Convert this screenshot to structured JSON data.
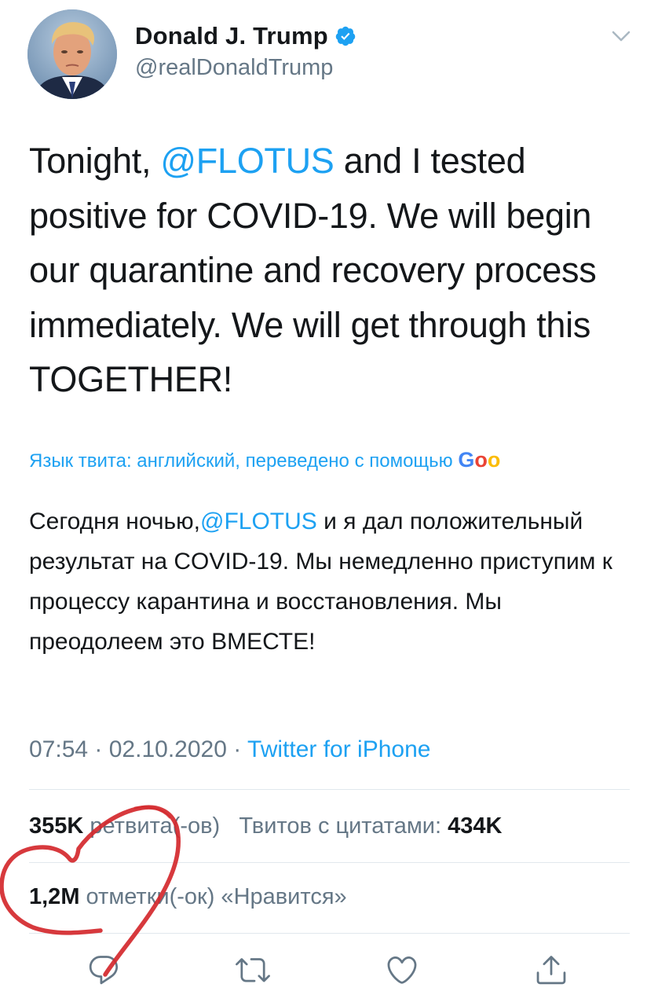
{
  "author": {
    "display_name": "Donald J. Trump",
    "handle": "@realDonaldTrump",
    "verified": true
  },
  "tweet": {
    "segments": [
      "Tonight, ",
      "@FLOTUS",
      " and I tested positive for COVID-19. We will begin our quarantine and recovery process immediately. We will get through this TOGETHER!"
    ]
  },
  "translation": {
    "note": "Язык твита: английский, переведено с помощью ",
    "provider": [
      "G",
      "o",
      "o"
    ],
    "segments": [
      "Сегодня ночью,",
      "@FLOTUS",
      " и я дал положительный результат на COVID-19. Мы немедленно приступим к процессу карантина и восстановления. Мы преодолеем это ВМЕСТЕ!"
    ]
  },
  "meta": {
    "time": "07:54",
    "separator": " · ",
    "date": "02.10.2020",
    "source": "Twitter for iPhone"
  },
  "stats": {
    "retweets_count": "355K",
    "retweets_label": "ретвита(-ов)",
    "quotes_label": "Твитов с цитатами:",
    "quotes_count": "434K",
    "likes_count": "1,2M",
    "likes_label": "отметки(-ок) «Нравится»"
  },
  "icons": {
    "verified": "verified-badge-icon",
    "chevron": "chevron-down-icon",
    "reply": "reply-icon",
    "retweet": "retweet-icon",
    "like": "heart-icon",
    "share": "share-icon"
  },
  "colors": {
    "accent": "#1da1f2",
    "secondary_text": "#657786",
    "annotation": "#d4282c"
  }
}
